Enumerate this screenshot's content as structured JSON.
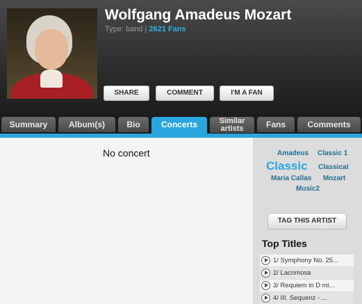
{
  "artist": {
    "name": "Wolfgang Amadeus Mozart",
    "type_label": "Type: band |",
    "fans": "2621 Fans"
  },
  "actions": {
    "share": "SHARE",
    "comment": "COMMENT",
    "fan": "I'M A FAN"
  },
  "tabs": {
    "summary": "Summary",
    "albums": "Album(s)",
    "bio": "Bio",
    "concerts": "Concerts",
    "similar_1": "Similar",
    "similar_2": "artists",
    "fans": "Fans",
    "comments": "Comments"
  },
  "main": {
    "empty_message": "No concert"
  },
  "tags": {
    "amadeus": "Amadeus",
    "classic1": "Classic 1",
    "classic": "Classic",
    "classical": "Classical",
    "maria_callas": "Maria Callas",
    "mozart": "Mozart",
    "music2": "Music2"
  },
  "sidebar": {
    "tag_button": "TAG THIS ARTIST",
    "top_titles": "Top Titles",
    "tracks": [
      "1/ Symphony No. 25...",
      "2/ Lacrimosa",
      "3/ Requiem in D mi...",
      "4/ III. Sequenz - ..."
    ]
  },
  "colors": {
    "accent": "#2aa6df",
    "tag_text": "#1f6f8f"
  }
}
